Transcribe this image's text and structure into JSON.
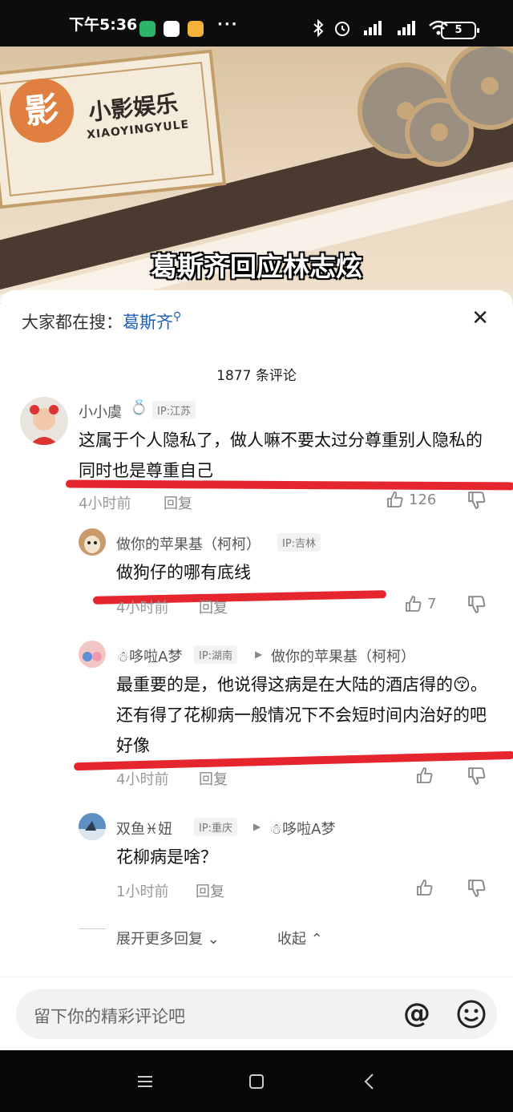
{
  "status_bar": {
    "time": "下午5:36",
    "dots": "···",
    "battery": "5"
  },
  "video": {
    "logo_char": "影",
    "logo_cn": "小影娱乐",
    "logo_en": "XIAOYINGYULE",
    "title": "葛斯齐回应林志炫"
  },
  "search": {
    "label": "大家都在搜：",
    "keyword": "葛斯齐"
  },
  "comment_count": "1877 条评论",
  "comments": [
    {
      "user": "小小虞",
      "ip": "IP:江苏",
      "text": "这属于个人隐私了，做人嘛不要太过分尊重别人隐私的同时也是尊重自己",
      "time": "4小时前",
      "reply": "回复",
      "likes": "126"
    },
    {
      "user": "做你的苹果基（柯柯）",
      "ip": "IP:吉林",
      "text": "做狗仔的哪有底线",
      "time": "4小时前",
      "reply": "回复",
      "likes": "7"
    },
    {
      "user": "☃哆啦A梦",
      "ip": "IP:湖南",
      "reply_to": "做你的苹果基（柯柯）",
      "text": "最重要的是，他说得这病是在大陆的酒店得的😚。还有得了花柳病一般情况下不会短时间内治好的吧好像",
      "time": "4小时前",
      "reply": "回复",
      "likes": ""
    },
    {
      "user": "双鱼♓妞",
      "ip": "IP:重庆",
      "reply_to": "☃哆啦A梦",
      "text": "花柳病是啥？",
      "time": "1小时前",
      "reply": "回复",
      "likes": ""
    }
  ],
  "thread_actions": {
    "expand": "展开更多回复",
    "collapse": "收起"
  },
  "input": {
    "placeholder": "留下你的精彩评论吧",
    "at": "@"
  },
  "colors": {
    "highlight_red": "#e5262e",
    "keyword_blue": "#1d5fb5"
  }
}
